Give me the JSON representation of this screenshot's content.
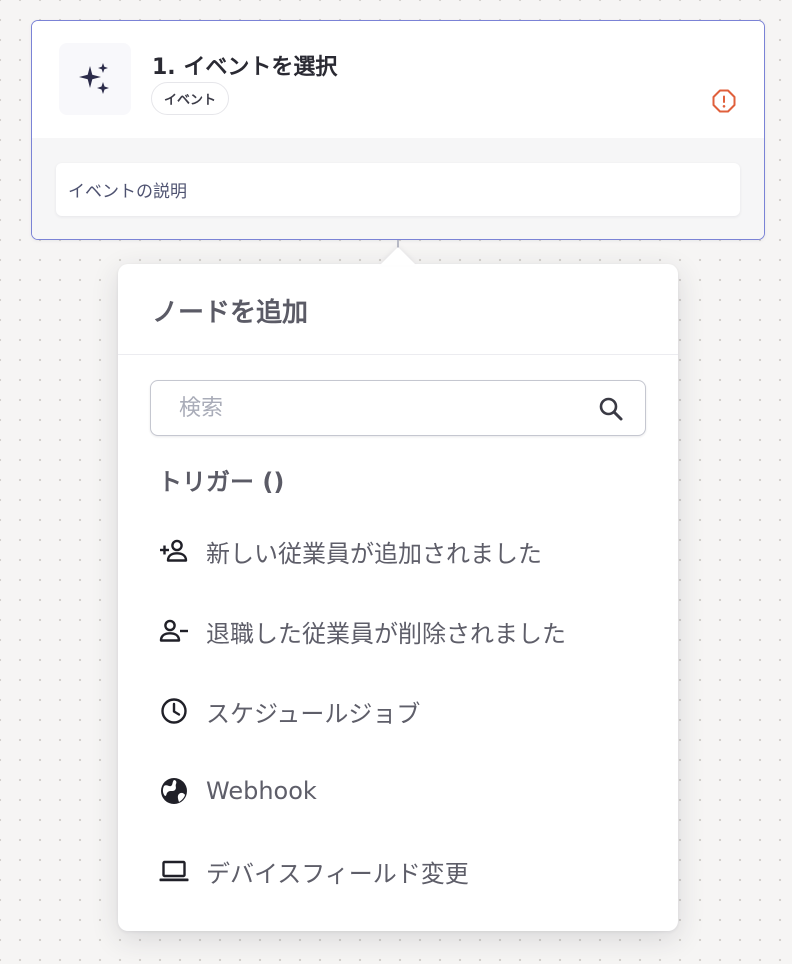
{
  "node": {
    "title": "1. イベントを選択",
    "badge": "イベント",
    "description": "イベントの説明",
    "icon": "sparkles-icon",
    "status_icon": "warning-icon",
    "accent_color": "#7b83d6",
    "warning_color": "#e0603c"
  },
  "popup": {
    "title": "ノードを追加",
    "search": {
      "placeholder": "検索",
      "value": ""
    },
    "section_label": "トリガー ()",
    "items": [
      {
        "label": "新しい従業員が追加されました",
        "icon": "person-add-icon"
      },
      {
        "label": "退職した従業員が削除されました",
        "icon": "person-remove-icon"
      },
      {
        "label": "スケジュールジョブ",
        "icon": "clock-icon"
      },
      {
        "label": "Webhook",
        "icon": "globe-icon"
      },
      {
        "label": "デバイスフィールド変更",
        "icon": "laptop-icon"
      }
    ]
  }
}
